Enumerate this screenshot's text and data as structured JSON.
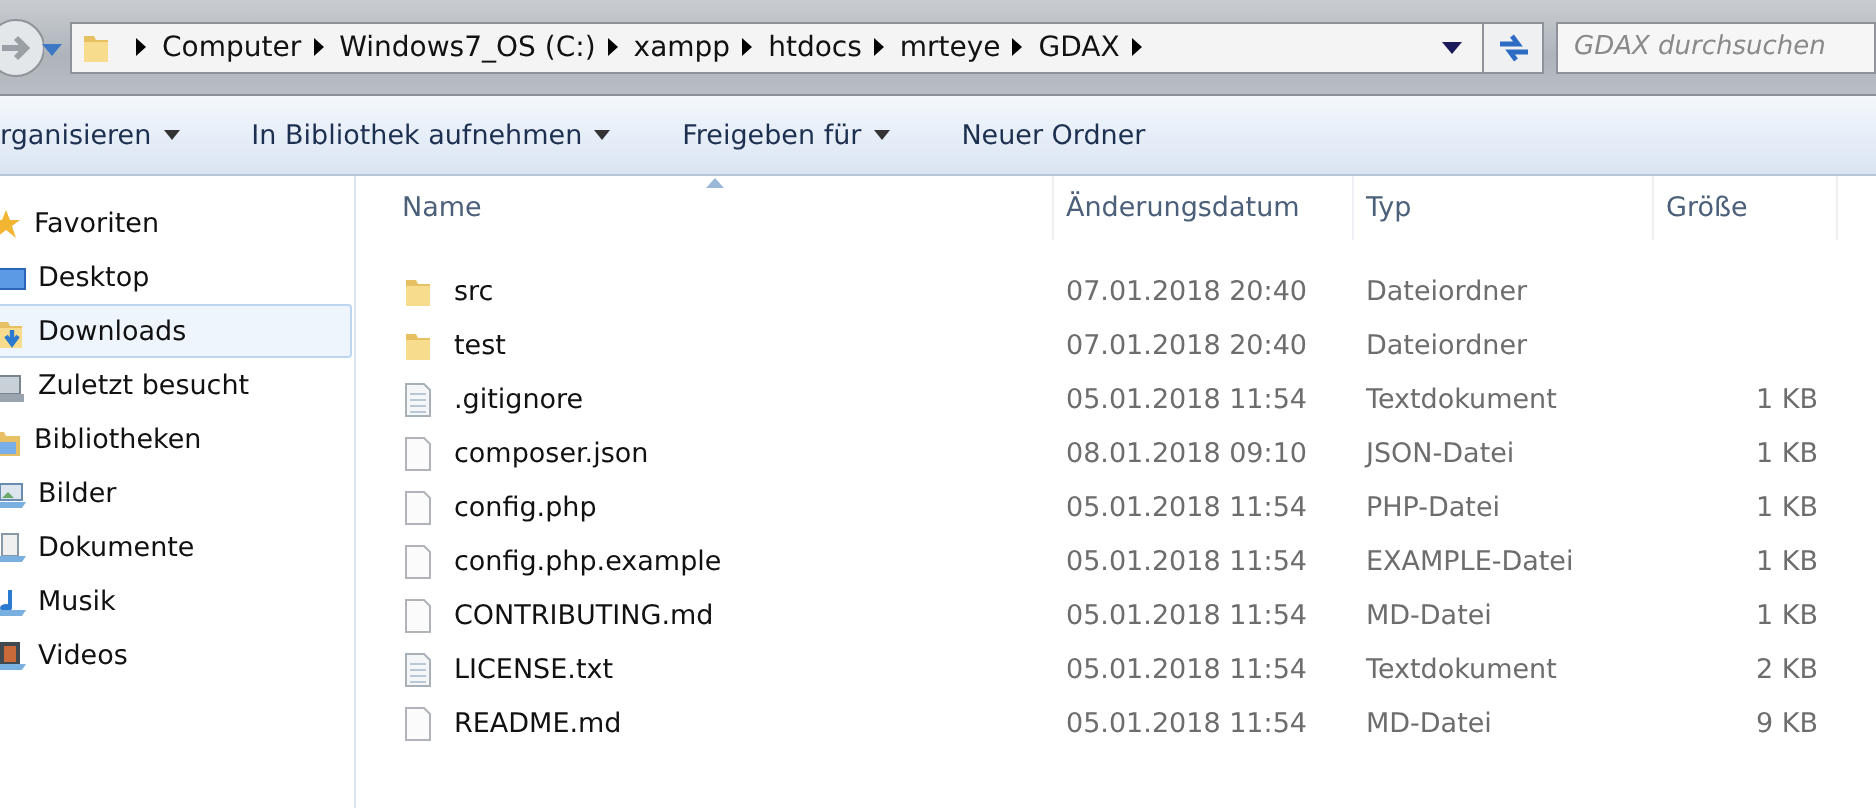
{
  "address_bar": {
    "breadcrumbs": [
      "Computer",
      "Windows7_OS (C:)",
      "xampp",
      "htdocs",
      "mrteye",
      "GDAX"
    ]
  },
  "search": {
    "placeholder": "GDAX durchsuchen"
  },
  "toolbar": [
    {
      "label": "rganisieren",
      "dropdown": true
    },
    {
      "label": "In Bibliothek aufnehmen",
      "dropdown": true
    },
    {
      "label": "Freigeben für",
      "dropdown": true
    },
    {
      "label": "Neuer Ordner",
      "dropdown": false
    }
  ],
  "sidebar": {
    "groups": [
      {
        "label": "Favoriten",
        "kind": "favorites",
        "children": [
          {
            "label": "Desktop",
            "kind": "desktop",
            "selected": false
          },
          {
            "label": "Downloads",
            "kind": "downloads",
            "selected": true
          },
          {
            "label": "Zuletzt besucht",
            "kind": "recent",
            "selected": false
          }
        ]
      },
      {
        "label": "Bibliotheken",
        "kind": "libraries",
        "children": [
          {
            "label": "Bilder",
            "kind": "pictures",
            "selected": false
          },
          {
            "label": "Dokumente",
            "kind": "documents",
            "selected": false
          },
          {
            "label": "Musik",
            "kind": "music",
            "selected": false
          },
          {
            "label": "Videos",
            "kind": "videos",
            "selected": false
          }
        ]
      }
    ]
  },
  "table": {
    "columns": [
      {
        "label": "Name",
        "sorted": true
      },
      {
        "label": "Änderungsdatum",
        "sorted": false
      },
      {
        "label": "Typ",
        "sorted": false
      },
      {
        "label": "Größe",
        "sorted": false
      }
    ],
    "rows": [
      {
        "kind": "folder",
        "name": "src",
        "modified": "07.01.2018 20:40",
        "type": "Dateiordner"
      },
      {
        "kind": "folder",
        "name": "test",
        "modified": "07.01.2018 20:40",
        "type": "Dateiordner"
      },
      {
        "kind": "text",
        "name": ".gitignore",
        "modified": "05.01.2018 11:54",
        "type": "Textdokument",
        "size": "1 KB"
      },
      {
        "kind": "file",
        "name": "composer.json",
        "modified": "08.01.2018 09:10",
        "type": "JSON-Datei",
        "size": "1 KB"
      },
      {
        "kind": "file",
        "name": "config.php",
        "modified": "05.01.2018 11:54",
        "type": "PHP-Datei",
        "size": "1 KB"
      },
      {
        "kind": "file",
        "name": "config.php.example",
        "modified": "05.01.2018 11:54",
        "type": "EXAMPLE-Datei",
        "size": "1 KB"
      },
      {
        "kind": "file",
        "name": "CONTRIBUTING.md",
        "modified": "05.01.2018 11:54",
        "type": "MD-Datei",
        "size": "1 KB"
      },
      {
        "kind": "text",
        "name": "LICENSE.txt",
        "modified": "05.01.2018 11:54",
        "type": "Textdokument",
        "size": "2 KB"
      },
      {
        "kind": "file",
        "name": "README.md",
        "modified": "05.01.2018 11:54",
        "type": "MD-Datei",
        "size": "9 KB"
      }
    ]
  }
}
